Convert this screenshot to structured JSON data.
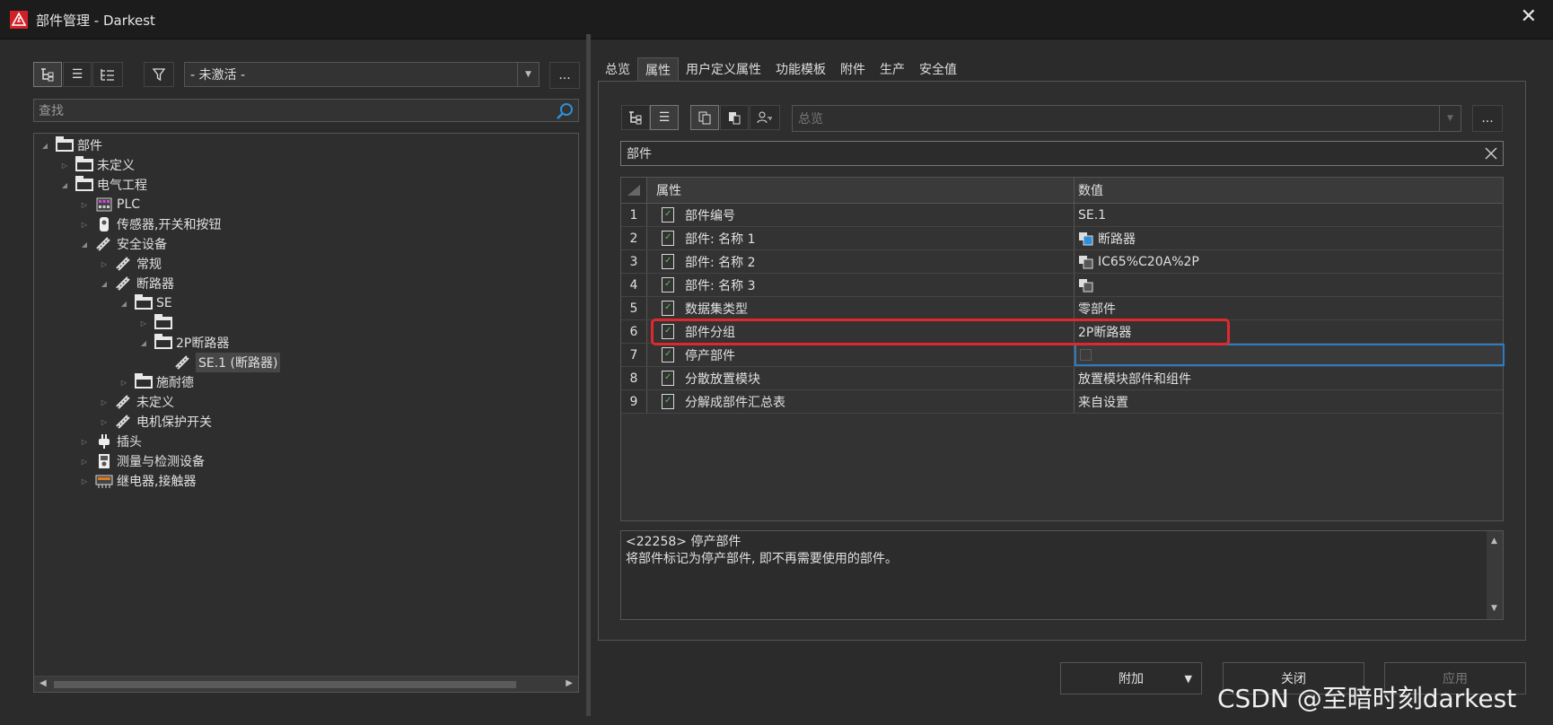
{
  "window": {
    "title": "部件管理 - Darkest"
  },
  "left": {
    "filter_combo": "- 未激活 -",
    "more_label": "...",
    "search_placeholder": "查找",
    "tree": [
      "部件",
      "未定义",
      "电气工程",
      "PLC",
      "传感器,开关和按钮",
      "安全设备",
      "常规",
      "断路器",
      "SE",
      "",
      "2P断路器",
      "SE.1 (断路器)",
      "施耐德",
      "未定义",
      "电机保护开关",
      "插头",
      "测量与检测设备",
      "继电器,接触器"
    ]
  },
  "right": {
    "tabs": [
      "总览",
      "属性",
      "用户定义属性",
      "功能模板",
      "附件",
      "生产",
      "安全值"
    ],
    "view_combo": "总览",
    "more_label": "...",
    "section_label": "部件",
    "grid": {
      "header_prop": "属性",
      "header_val": "数值",
      "rows": [
        {
          "num": "1",
          "prop": "部件编号",
          "val": "SE.1"
        },
        {
          "num": "2",
          "prop": "部件: 名称 1",
          "val": "断路器"
        },
        {
          "num": "3",
          "prop": "部件: 名称 2",
          "val": "IC65%C20A%2P"
        },
        {
          "num": "4",
          "prop": "部件: 名称 3",
          "val": ""
        },
        {
          "num": "5",
          "prop": "数据集类型",
          "val": "零部件"
        },
        {
          "num": "6",
          "prop": "部件分组",
          "val": "2P断路器"
        },
        {
          "num": "7",
          "prop": "停产部件",
          "val": ""
        },
        {
          "num": "8",
          "prop": "分散放置模块",
          "val": "放置模块部件和组件"
        },
        {
          "num": "9",
          "prop": "分解成部件汇总表",
          "val": "来自设置"
        }
      ]
    },
    "description": {
      "line1": "<22258> 停产部件",
      "line2": "将部件标记为停产部件, 即不再需要使用的部件。"
    }
  },
  "buttons": {
    "attach": "附加",
    "close": "关闭",
    "apply": "应用"
  },
  "watermark": "CSDN @至暗时刻darkest"
}
